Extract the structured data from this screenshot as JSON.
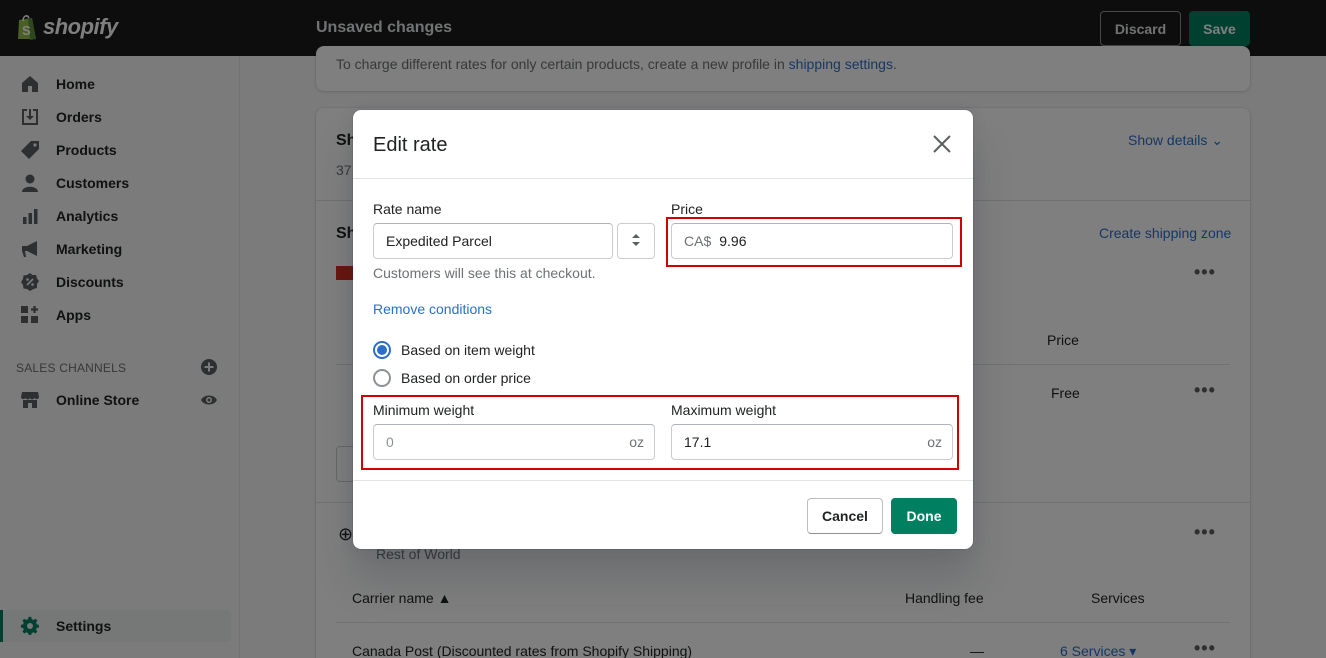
{
  "app": {
    "brand": "shopify",
    "status_title": "Unsaved changes"
  },
  "topbar": {
    "discard_label": "Discard",
    "save_label": "Save"
  },
  "sidebar": {
    "items": [
      {
        "label": "Home",
        "icon": "home-icon"
      },
      {
        "label": "Orders",
        "icon": "orders-icon"
      },
      {
        "label": "Products",
        "icon": "tag-icon"
      },
      {
        "label": "Customers",
        "icon": "person-icon"
      },
      {
        "label": "Analytics",
        "icon": "bar-chart-icon"
      },
      {
        "label": "Marketing",
        "icon": "megaphone-icon"
      },
      {
        "label": "Discounts",
        "icon": "discount-icon"
      },
      {
        "label": "Apps",
        "icon": "apps-icon"
      }
    ],
    "sales_channels_title": "SALES CHANNELS",
    "channels": [
      {
        "label": "Online Store",
        "icon": "store-icon"
      }
    ],
    "settings_label": "Settings"
  },
  "background": {
    "profile_note": "To charge different rates for only certain products, create a new profile in",
    "profile_note_link": "shipping settings",
    "section1_title_frag": "Sh",
    "section1_sub_frag": "37",
    "show_details": "Show details",
    "section2_title_frag": "Sh",
    "create_zone": "Create shipping zone",
    "price_header": "Price",
    "price_value": "Free",
    "rest_of_world": "Rest of World",
    "carrier_name_header": "Carrier name",
    "handling_fee_header": "Handling fee",
    "services_header": "Services",
    "carrier_name": "Canada Post (Discounted rates from Shopify Shipping)",
    "carrier_fee": "—",
    "carrier_services": "6 Services"
  },
  "modal": {
    "title": "Edit rate",
    "rate_name_label": "Rate name",
    "rate_name_value": "Expedited Parcel",
    "rate_name_help": "Customers will see this at checkout.",
    "price_label": "Price",
    "price_prefix": "CA$",
    "price_value": "9.96",
    "remove_conditions": "Remove conditions",
    "radio_options": [
      {
        "label": "Based on item weight",
        "checked": true
      },
      {
        "label": "Based on order price",
        "checked": false
      }
    ],
    "min_weight_label": "Minimum weight",
    "min_weight_placeholder": "0",
    "min_weight_suffix": "oz",
    "max_weight_label": "Maximum weight",
    "max_weight_value": "17.1",
    "max_weight_suffix": "oz",
    "cancel_label": "Cancel",
    "done_label": "Done"
  },
  "colors": {
    "primary_green": "#008060",
    "link_blue": "#2c6ecb",
    "highlight_red": "#d40000",
    "topbar_bg": "#1a1a1a"
  }
}
